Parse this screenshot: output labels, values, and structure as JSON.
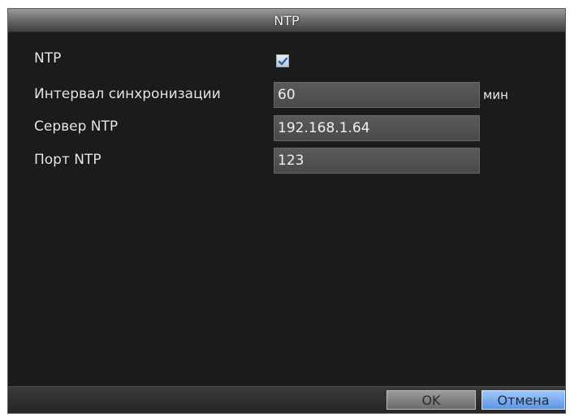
{
  "window": {
    "title": "NTP"
  },
  "form": {
    "ntp_label": "NTP",
    "ntp_enabled": true,
    "interval_label": "Интервал синхронизации",
    "interval_value": "60",
    "interval_unit": "мин",
    "server_label": "Сервер NTP",
    "server_value": "192.168.1.64",
    "port_label": "Порт NTP",
    "port_value": "123"
  },
  "buttons": {
    "ok_label": "OK",
    "cancel_label": "Отмена"
  },
  "colors": {
    "accent": "#6ea6f2",
    "background": "#1b1b1b"
  },
  "icons": {
    "checkbox": "checkmark-icon"
  }
}
